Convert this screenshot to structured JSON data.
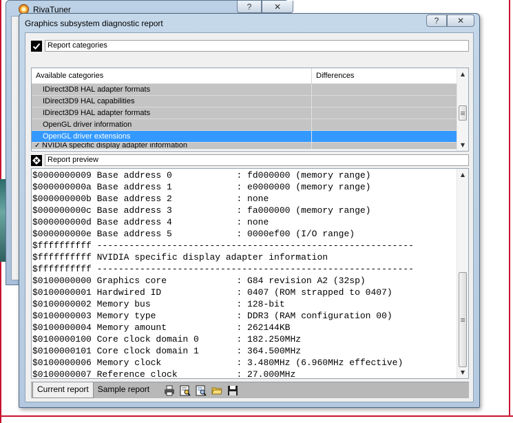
{
  "back_window": {
    "title": "RivaTuner",
    "help_label": "?",
    "close_label": "✕"
  },
  "dialog": {
    "title": "Graphics subsystem diagnostic report",
    "help_label": "?",
    "close_label": "✕",
    "categories_section": {
      "label": "Report categories",
      "checked": true,
      "columns": [
        "Available categories",
        "Differences"
      ],
      "items": [
        {
          "label": "IDirect3D8 HAL adapter formats",
          "difference": "",
          "selected": false
        },
        {
          "label": "IDirect3D9 HAL capabilities",
          "difference": "",
          "selected": false
        },
        {
          "label": "IDirect3D9 HAL adapter formats",
          "difference": "",
          "selected": false
        },
        {
          "label": "OpenGL driver information",
          "difference": "",
          "selected": false
        },
        {
          "label": "OpenGL driver extensions",
          "difference": "",
          "selected": true
        },
        {
          "label": "NVIDIA specific display adapter information",
          "difference": "",
          "selected": false,
          "checkmark": true
        }
      ]
    },
    "preview_section": {
      "label": "Report preview",
      "lines": [
        "$0000000009 Base address 0            : fd000000 (memory range)",
        "$000000000a Base address 1            : e0000000 (memory range)",
        "$000000000b Base address 2            : none",
        "$000000000c Base address 3            : fa000000 (memory range)",
        "$000000000d Base address 4            : none",
        "$000000000e Base address 5            : 0000ef00 (I/O range)",
        "$ffffffffff -----------------------------------------------------------",
        "$ffffffffff NVIDIA specific display adapter information",
        "$ffffffffff -----------------------------------------------------------",
        "$0100000000 Graphics core             : G84 revision A2 (32sp)",
        "$0100000001 Hardwired ID              : 0407 (ROM strapped to 0407)",
        "$0100000002 Memory bus                : 128-bit",
        "$0100000003 Memory type               : DDR3 (RAM configuration 00)",
        "$0100000004 Memory amount             : 262144KB",
        "$0100000100 Core clock domain 0       : 182.250MHz",
        "$0100000101 Core clock domain 1       : 364.500MHz",
        "$0100000006 Memory clock              : 3.480MHz (6.960MHz effective)",
        "$0100000007 Reference clock           : 27.000MHz"
      ]
    },
    "tabs": [
      {
        "label": "Current report",
        "active": true
      },
      {
        "label": "Sample report",
        "active": false
      }
    ],
    "toolbar_icons": [
      "printer-icon",
      "view-report-icon",
      "compare-report-icon",
      "open-folder-icon",
      "save-disk-icon"
    ]
  },
  "colors": {
    "selection": "#3399ff",
    "list_row": "#c4c4c4",
    "title_bar": "#c5d8ea"
  }
}
